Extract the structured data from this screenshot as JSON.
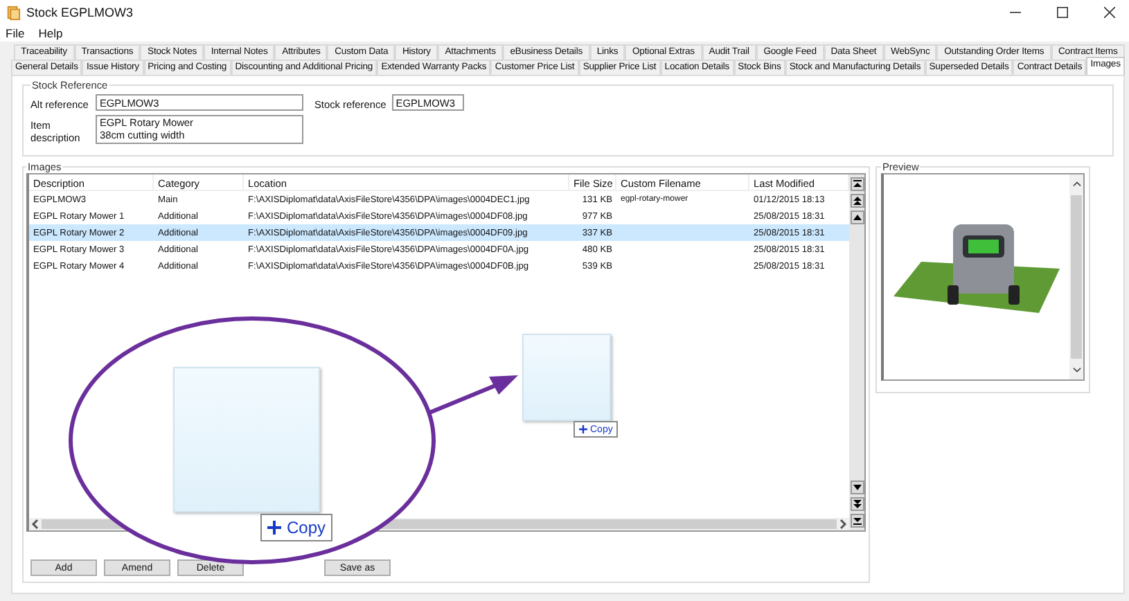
{
  "window": {
    "title": "Stock EGPLMOW3"
  },
  "menu": [
    "File",
    "Help"
  ],
  "tab_rows": [
    [
      {
        "label": "Traceability",
        "selected": false
      },
      {
        "label": "Transactions",
        "selected": false
      },
      {
        "label": "Stock Notes",
        "selected": false
      },
      {
        "label": "Internal Notes",
        "selected": false
      },
      {
        "label": "Attributes",
        "selected": false
      },
      {
        "label": "Custom Data",
        "selected": false
      },
      {
        "label": "History",
        "selected": false
      },
      {
        "label": "Attachments",
        "selected": false
      },
      {
        "label": "eBusiness Details",
        "selected": false
      },
      {
        "label": "Links",
        "selected": false
      },
      {
        "label": "Optional Extras",
        "selected": false
      },
      {
        "label": "Audit Trail",
        "selected": false
      },
      {
        "label": "Google Feed",
        "selected": false
      },
      {
        "label": "Data Sheet",
        "selected": false
      },
      {
        "label": "WebSync",
        "selected": false
      },
      {
        "label": "Outstanding Order Items",
        "selected": false
      },
      {
        "label": "Contract Items",
        "selected": false
      }
    ],
    [
      {
        "label": "General Details",
        "selected": false
      },
      {
        "label": "Issue History",
        "selected": false
      },
      {
        "label": "Pricing and Costing",
        "selected": false
      },
      {
        "label": "Discounting and Additional Pricing",
        "selected": false
      },
      {
        "label": "Extended Warranty Packs",
        "selected": false
      },
      {
        "label": "Customer Price List",
        "selected": false
      },
      {
        "label": "Supplier Price List",
        "selected": false
      },
      {
        "label": "Location Details",
        "selected": false
      },
      {
        "label": "Stock Bins",
        "selected": false
      },
      {
        "label": "Stock and Manufacturing Details",
        "selected": false
      },
      {
        "label": "Superseded Details",
        "selected": false
      },
      {
        "label": "Contract Details",
        "selected": false
      },
      {
        "label": "Images",
        "selected": true
      }
    ]
  ],
  "stock_reference": {
    "title": "Stock Reference",
    "alt_reference_label": "Alt reference",
    "alt_reference": "EGPLMOW3",
    "stock_reference_label": "Stock reference",
    "stock_reference": "EGPLMOW3",
    "item_description_label": "Item description",
    "item_description": [
      "EGPL Rotary Mower",
      "38cm cutting width"
    ]
  },
  "images": {
    "title": "Images",
    "columns": [
      "Description",
      "Category",
      "Location",
      "File Size",
      "Custom Filename",
      "Last Modified"
    ],
    "rows": [
      {
        "cells": [
          "EGPLMOW3",
          "Main",
          "F:\\AXISDiplomat\\data\\AxisFileStore\\4356\\DPA\\images\\0004DEC1.jpg",
          "131 KB",
          "egpl-rotary-mower",
          "01/12/2015 18:13"
        ],
        "selected": false
      },
      {
        "cells": [
          "EGPL Rotary Mower 1",
          "Additional",
          "F:\\AXISDiplomat\\data\\AxisFileStore\\4356\\DPA\\images\\0004DF08.jpg",
          "977 KB",
          "",
          "25/08/2015 18:31"
        ],
        "selected": false
      },
      {
        "cells": [
          "EGPL Rotary Mower 2",
          "Additional",
          "F:\\AXISDiplomat\\data\\AxisFileStore\\4356\\DPA\\images\\0004DF09.jpg",
          "337 KB",
          "",
          "25/08/2015 18:31"
        ],
        "selected": true
      },
      {
        "cells": [
          "EGPL Rotary Mower 3",
          "Additional",
          "F:\\AXISDiplomat\\data\\AxisFileStore\\4356\\DPA\\images\\0004DF0A.jpg",
          "480 KB",
          "",
          "25/08/2015 18:31"
        ],
        "selected": false
      },
      {
        "cells": [
          "EGPL Rotary Mower 4",
          "Additional",
          "F:\\AXISDiplomat\\data\\AxisFileStore\\4356\\DPA\\images\\0004DF0B.jpg",
          "539 KB",
          "",
          "25/08/2015 18:31"
        ],
        "selected": false
      }
    ],
    "buttons": [
      "Add",
      "Amend",
      "Delete",
      "Save as"
    ]
  },
  "preview": {
    "title": "Preview"
  },
  "drag_overlay": {
    "copy_labels": [
      "Copy",
      "Copy"
    ]
  }
}
